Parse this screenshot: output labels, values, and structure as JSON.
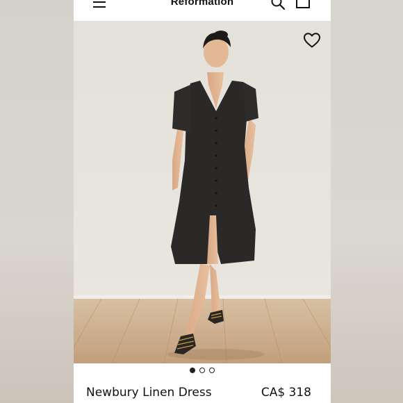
{
  "header": {
    "brand": "Reformation",
    "menu_icon": "hamburger-menu-icon",
    "search_icon": "search-icon",
    "bag_icon": "shopping-bag-icon"
  },
  "product": {
    "name": "Newbury Linen Dress",
    "price": "CA$ 318",
    "favorite_icon": "heart-icon"
  },
  "gallery": {
    "image_count": 3,
    "active_index": 1
  },
  "colors": {
    "background": "#ffffff",
    "text": "#111111",
    "dress": "#2a2826",
    "wall": "#e6e2dc",
    "floor": "#c9ad8d"
  }
}
